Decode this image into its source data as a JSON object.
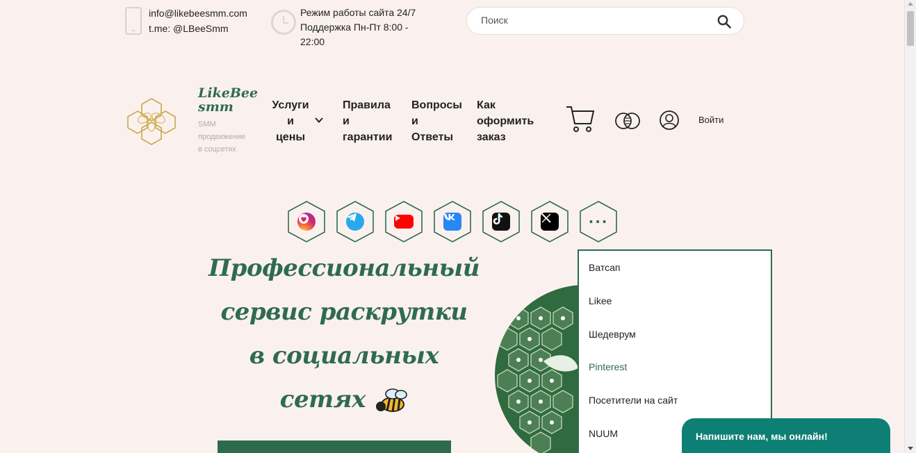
{
  "contact": {
    "email": "info@likebeesmm.com",
    "telegram": "t.me: @LBeeSmm"
  },
  "hours": {
    "line1": "Режим работы сайта 24/7",
    "line2": "Поддержка Пн-Пт 8:00 -",
    "line3": "22:00"
  },
  "search": {
    "placeholder": "Поиск"
  },
  "brand": {
    "name_line1": "LikeBee",
    "name_line2": "smm",
    "tagline_line1": "SMM",
    "tagline_line2": "продвижение",
    "tagline_line3": "в соцсетях"
  },
  "nav": {
    "services": [
      "Услуги",
      "и",
      "цены"
    ],
    "rules": [
      "Правила",
      "и",
      "гарантии"
    ],
    "faq": [
      "Вопросы",
      "и",
      "Ответы"
    ],
    "howto": [
      "Как",
      "оформить",
      "заказ"
    ],
    "login": "Войти"
  },
  "social": {
    "items": [
      {
        "icon": "instagram-heart-icon",
        "color": "#e0317a"
      },
      {
        "icon": "telegram-icon",
        "color": "#29a9eb"
      },
      {
        "icon": "youtube-icon",
        "color": "#ff0000"
      },
      {
        "icon": "vk-icon",
        "color": "#2787f5"
      },
      {
        "icon": "tiktok-icon",
        "color": "#111111"
      },
      {
        "icon": "x-icon",
        "color": "#000000"
      },
      {
        "icon": "more-dots-icon",
        "color": "#2f6b4e"
      }
    ],
    "more_label": "···"
  },
  "hero": {
    "line1": "Профессиональный",
    "line2": "сервис раскрутки",
    "line3": "в социальных",
    "line4": "сетях"
  },
  "dropdown": {
    "items": [
      "Ватсап",
      "Likee",
      "Шедеврум",
      "Pinterest",
      "Посетители на сайт",
      "NUUM"
    ],
    "active_index": 3
  },
  "chat": {
    "label": "Напишите нам, мы онлайн!"
  },
  "colors": {
    "brand_green": "#2f6b4e",
    "background": "#faf1ee",
    "chat_teal": "#0e7f74"
  }
}
